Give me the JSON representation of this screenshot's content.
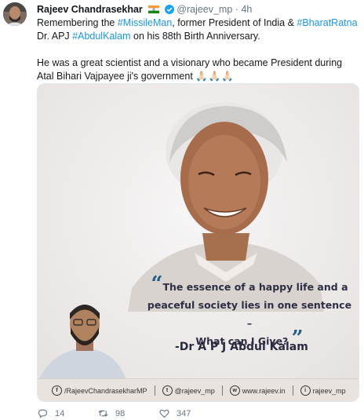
{
  "tweet": {
    "author_name": "Rajeev Chandrasekhar",
    "handle": "@rajeev_mp",
    "dot": "·",
    "time": "4h",
    "line1_pre": "Remembering the ",
    "tag_missileman": "#MissileMan",
    "line1_mid": ",  former President of India & ",
    "tag_bharatratna": "#BharatRatna",
    "line1_post": " Dr. APJ ",
    "tag_abdulkalam": "#AbdulKalam",
    "line1_end": " on his 88th Birth Anniversary.",
    "line2": "He was a great scientist and a visionary who became President during Atal Bihari Vajpayee ji's government",
    "emoji": "🙏🏻🙏🏻🙏🏻"
  },
  "media": {
    "quote_line1": "The essence of a happy life and a",
    "quote_line2": "peaceful society lies in one sentence –",
    "quote_line3": "What can I Give?",
    "author": "-Dr A P J Abdul Kalam",
    "footer": {
      "facebook": "/RajeevChandrasekharMP",
      "twitter": "@rajeev_mp",
      "web": "www.rajeev.in",
      "instagram": "rajeev_mp"
    }
  },
  "actions": {
    "reply_count": "14",
    "retweet_count": "98",
    "like_count": "347"
  },
  "colors": {
    "link": "#1b95e0",
    "muted": "#657786",
    "quote_mark": "#1f5f86"
  }
}
